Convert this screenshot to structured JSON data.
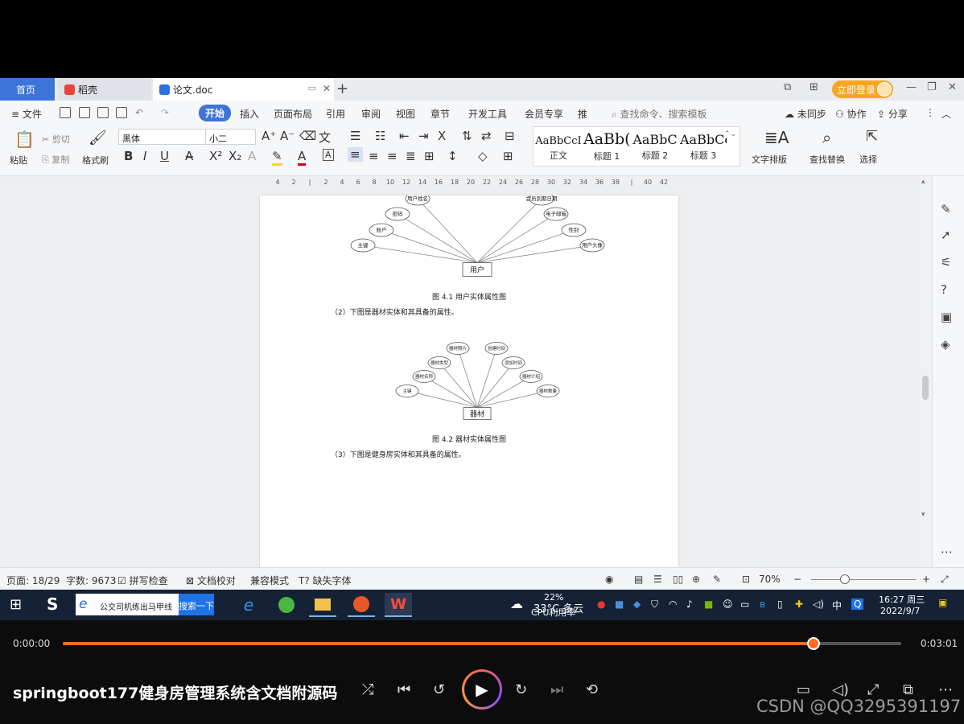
{
  "tabs": {
    "home": "首页",
    "daoke": "稻壳",
    "document": "论文.doc",
    "login": "立即登录"
  },
  "menu": {
    "file": "文件",
    "items": [
      "开始",
      "插入",
      "页面布局",
      "引用",
      "审阅",
      "视图",
      "章节",
      "开发工具",
      "会员专享",
      "推"
    ],
    "search_placeholder": "查找命令、搜索模板",
    "sync": "未同步",
    "collab": "协作",
    "share": "分享"
  },
  "ribbon": {
    "paste": "粘贴",
    "cut": "剪切",
    "copy": "复制",
    "format_painter": "格式刷",
    "font_name": "黑体",
    "font_size": "小二",
    "styles": [
      {
        "sample": "AaBbCcI",
        "name": "正文"
      },
      {
        "sample": "AaBb(",
        "name": "标题 1"
      },
      {
        "sample": "AaBbC",
        "name": "标题 2"
      },
      {
        "sample": "AaBbCc",
        "name": "标题 3"
      }
    ],
    "text_layout": "文字排版",
    "find_replace": "查找替换",
    "select": "选择"
  },
  "ruler_ticks": [
    "4",
    "2",
    "",
    "2",
    "4",
    "6",
    "8",
    "10",
    "12",
    "14",
    "16",
    "18",
    "20",
    "22",
    "24",
    "26",
    "28",
    "30",
    "32",
    "34",
    "36",
    "38",
    "",
    "40",
    "42"
  ],
  "document": {
    "fig1": {
      "center": "用户",
      "attributes": [
        "主键",
        "账户",
        "密码",
        "用户姓名",
        "会员到期日期",
        "电子邮箱",
        "性别",
        "用户头像"
      ],
      "caption": "图 4.1 用户实体属性图"
    },
    "para2": "（2）下图是器材实体和其具备的属性。",
    "fig2": {
      "center": "器材",
      "attributes": [
        "主键",
        "器材名称",
        "器材类型",
        "器材照片",
        "创建时间",
        "添加时间",
        "器材介绍",
        "器材数量"
      ],
      "caption": "图 4.2 器材实体属性图"
    },
    "para3": "（3）下图是健身房实体和其具备的属性。"
  },
  "status": {
    "page": "页面: 18/29",
    "words": "字数: 9673",
    "spell": "拼写检查",
    "proof": "文档校对",
    "compat": "兼容模式",
    "missing_font": "缺失字体",
    "zoom": "70%"
  },
  "taskbar": {
    "search_text": "公交司机练出马甲线",
    "search_button": "搜索一下",
    "weather": "33°C 多云",
    "cpu_percent": "22%",
    "cpu_label": "CPU利用率",
    "ime": "中",
    "time": "16:27 周三",
    "date": "2022/9/7"
  },
  "player": {
    "current_time": "0:00:00",
    "total_time": "0:03:01",
    "progress": 0.895,
    "title": "springboot177健身房管理系统含文档附源码",
    "watermark": "CSDN @QQ3295391197"
  },
  "colors": {
    "accent_blue": "#3c74d9",
    "progress_orange": "#ff6a24",
    "login_orange": "#f5a623"
  }
}
